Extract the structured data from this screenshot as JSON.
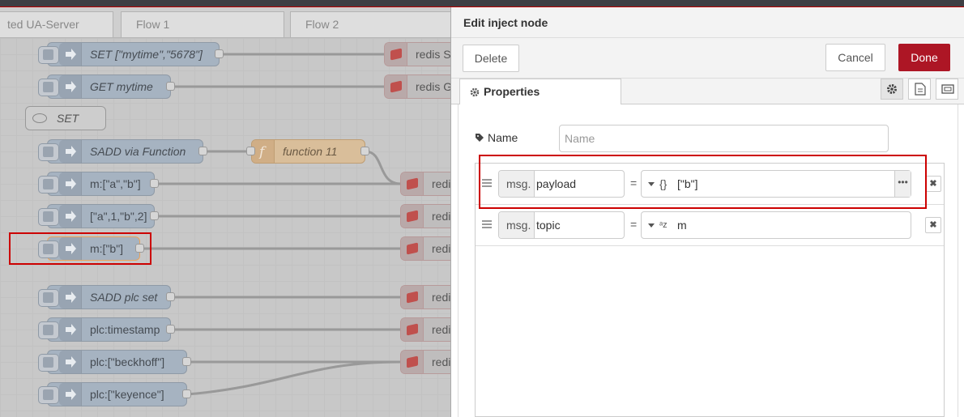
{
  "workspace": {
    "tabs": [
      "ted UA-Server",
      "Flow 1",
      "Flow 2"
    ],
    "nodes": {
      "set_mytime": "SET [\"mytime\",\"5678\"]",
      "get_mytime": "GET mytime",
      "sadd_via_function": "SADD via Function",
      "m_a_b": "m:[\"a\",\"b\"]",
      "a_1_b_2": "[\"a\",1,\"b\",2]",
      "m_b": "m:[\"b\"]",
      "sadd_plc_set": "SADD plc set",
      "plc_timestamp": "plc:timestamp",
      "plc_beckhoff": "plc:[\"beckhoff\"]",
      "plc_keyence": "plc:[\"keyence\"]"
    },
    "comment": "SET",
    "function_node": "function 11",
    "redis_labels": [
      "redis SE",
      "redis GE",
      "redis",
      "redis",
      "redis",
      "redis",
      "redis",
      "redis"
    ]
  },
  "editor": {
    "title": "Edit inject node",
    "delete_label": "Delete",
    "cancel_label": "Cancel",
    "done_label": "Done",
    "tab_label": "Properties",
    "name_label": "Name",
    "name_placeholder": "Name",
    "properties": [
      {
        "prefix": "msg.",
        "key": "payload",
        "eq": "=",
        "type_icon": "{}",
        "value": "[\"b\"]",
        "more": "•••"
      },
      {
        "prefix": "msg.",
        "key": "topic",
        "eq": "=",
        "type_icon": "ᵃz",
        "value": "m"
      }
    ],
    "delete_row_icon": "✖"
  },
  "colors": {
    "done": "#ad1625",
    "highlight": "#cc0000"
  }
}
